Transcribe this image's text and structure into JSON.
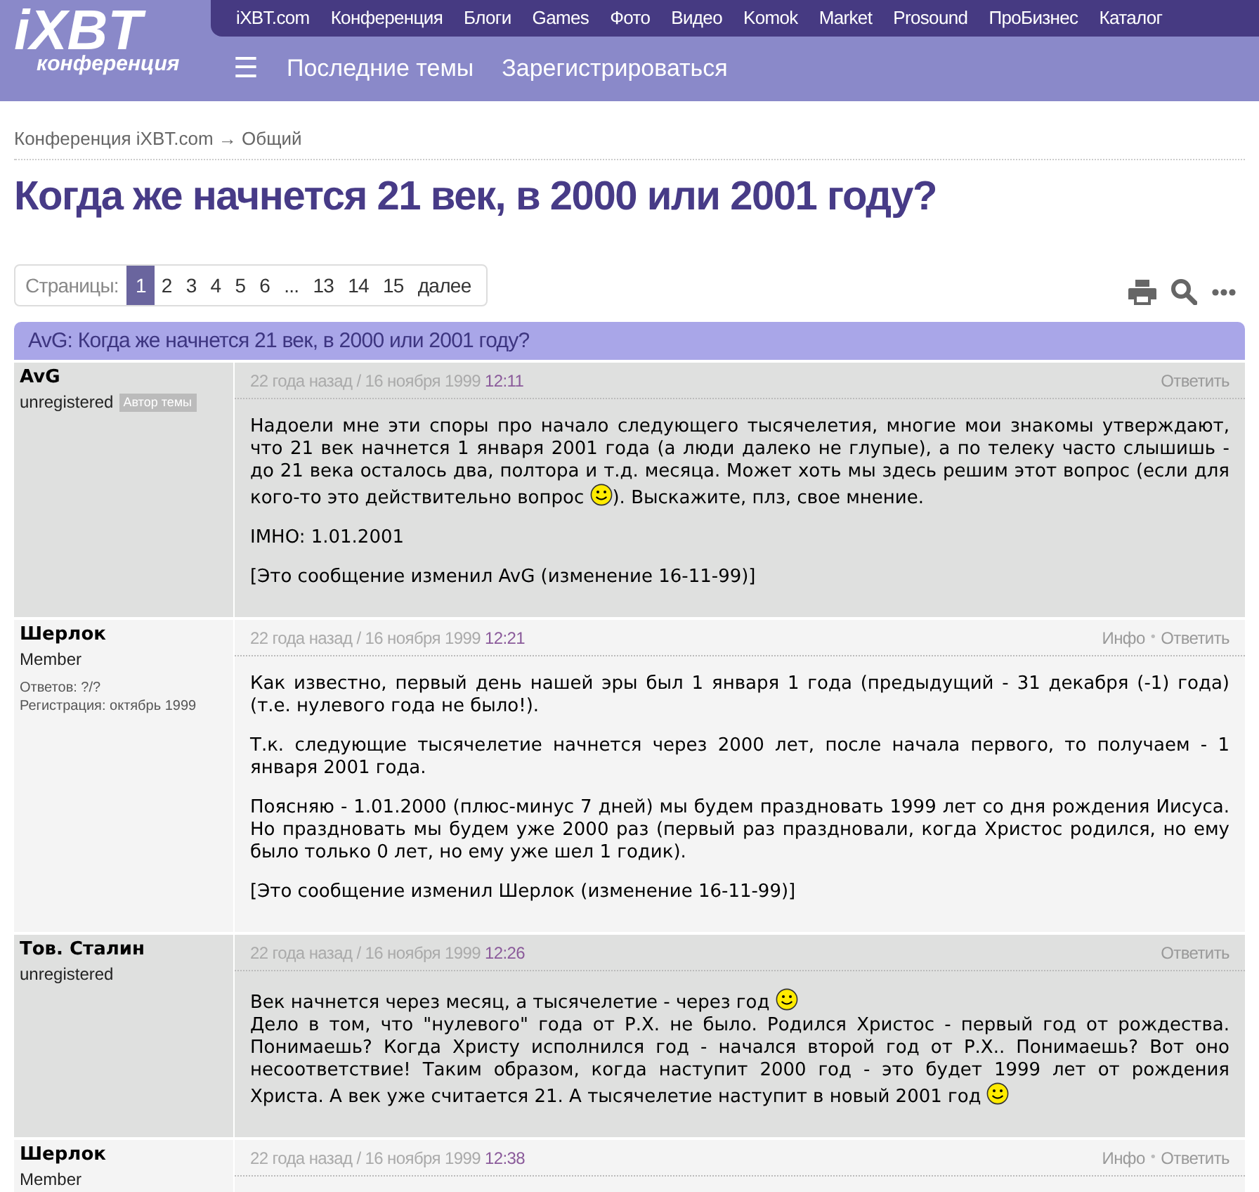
{
  "header": {
    "logo": {
      "main": "iXBT",
      "sub": "конференция"
    },
    "top_nav": [
      "iXBT.com",
      "Конференция",
      "Блоги",
      "Games",
      "Фото",
      "Видео",
      "Komok",
      "Market",
      "Prosound",
      "ПроБизнес",
      "Каталог"
    ],
    "menu_icon": "☰",
    "sub_nav": [
      "Последние темы",
      "Зарегистрироваться"
    ]
  },
  "breadcrumb": "Конференция iXBT.com → Общий",
  "title": "Когда же начнется 21 век, в 2000 или 2001 году?",
  "pagination": {
    "label": "Страницы:",
    "pages": [
      {
        "label": "1",
        "selected": true
      },
      {
        "label": "2",
        "selected": false
      },
      {
        "label": "3",
        "selected": false
      },
      {
        "label": "4",
        "selected": false
      },
      {
        "label": "5",
        "selected": false
      },
      {
        "label": "6",
        "selected": false
      },
      {
        "label": "...",
        "selected": false
      },
      {
        "label": "13",
        "selected": false
      },
      {
        "label": "14",
        "selected": false
      },
      {
        "label": "15",
        "selected": false
      },
      {
        "label": "далее",
        "selected": false
      }
    ]
  },
  "thread_header": "AvG: Когда же начнется 21 век, в 2000 или 2001 году?",
  "posts": [
    {
      "author": "AvG",
      "role": "unregistered",
      "badge": "Автор темы",
      "date": "22 года назад / 16 ноября 1999",
      "time": "12:11",
      "actions": [
        {
          "kind": "link",
          "text": "Ответить"
        }
      ],
      "paragraphs": [
        [
          {
            "kind": "text",
            "text": "Надоели мне эти споры про начало следующего тысячелетия, многие мои знакомы утверждают, что 21 век начнется 1 января 2001 года (а люди далеко не глупые), а по телеку часто слышишь - до 21 века осталось два, полтора и т.д. месяца. Может хоть мы здесь решим этот вопрос (если для кого-то это действительно вопрос "
          },
          {
            "kind": "smiley"
          },
          {
            "kind": "text",
            "text": "). Выскажите, плз, свое мнение."
          }
        ],
        [
          {
            "kind": "text",
            "text": "IMHO: 1.01.2001"
          }
        ],
        [
          {
            "kind": "text",
            "text": "[Это сообщение изменил AvG (изменение 16-11-99)]"
          }
        ]
      ]
    },
    {
      "author": "Шерлок",
      "role": "Member",
      "stats": [
        "Ответов: ?/?",
        "Регистрация: октябрь 1999"
      ],
      "date": "22 года назад / 16 ноября 1999",
      "time": "12:21",
      "actions": [
        {
          "kind": "link",
          "text": "Инфо"
        },
        {
          "kind": "separator",
          "text": "•"
        },
        {
          "kind": "link",
          "text": "Ответить"
        }
      ],
      "paragraphs": [
        [
          {
            "kind": "text",
            "text": "Как известно, первый день нашей эры был 1 января 1 года (предыдущий - 31 декабря (-1) года) (т.е. нулевого года не было!)."
          }
        ],
        [
          {
            "kind": "text",
            "text": "Т.к. следующие тысячелетие начнется через 2000 лет, после начала первого, то получаем - 1 января 2001 года."
          }
        ],
        [
          {
            "kind": "text",
            "text": "Поясняю - 1.01.2000 (плюс-минус 7 дней) мы будем праздновать 1999 лет со дня рождения Иисуса. Но праздновать мы будем уже 2000 раз (первый раз праздновали, когда Христос родился, но ему было только 0 лет, но ему уже шел 1 годик)."
          }
        ],
        [
          {
            "kind": "text",
            "text": "[Это сообщение изменил Шерлок (изменение 16-11-99)]"
          }
        ]
      ]
    },
    {
      "author": "Тов. Сталин",
      "role": "unregistered",
      "date": "22 года назад / 16 ноября 1999",
      "time": "12:26",
      "actions": [
        {
          "kind": "link",
          "text": "Ответить"
        }
      ],
      "paragraphs": [
        [
          {
            "kind": "text",
            "text": "Век начнется через месяц, а тысячелетие - через год "
          },
          {
            "kind": "smiley"
          },
          {
            "kind": "break"
          },
          {
            "kind": "text",
            "text": "Дело в том, что \"нулевого\" года от Р.Х. не было. Родился Христос - первый год от рождества. Понимаешь? Когда Христу исполнился год - начался второй год от Р.Х.. Понимаешь? Вот оно несоответствие! Таким образом, когда наступит 2000 год - это будет 1999 лет от рождения Христа. А век уже считается 21. А тысячелетие наступит в новый 2001 год "
          },
          {
            "kind": "smiley"
          }
        ]
      ]
    },
    {
      "author": "Шерлок",
      "role": "Member",
      "date": "22 года назад / 16 ноября 1999",
      "time": "12:38",
      "actions": [
        {
          "kind": "link",
          "text": "Инфо"
        },
        {
          "kind": "separator",
          "text": "•"
        },
        {
          "kind": "link",
          "text": "Ответить"
        }
      ]
    }
  ]
}
